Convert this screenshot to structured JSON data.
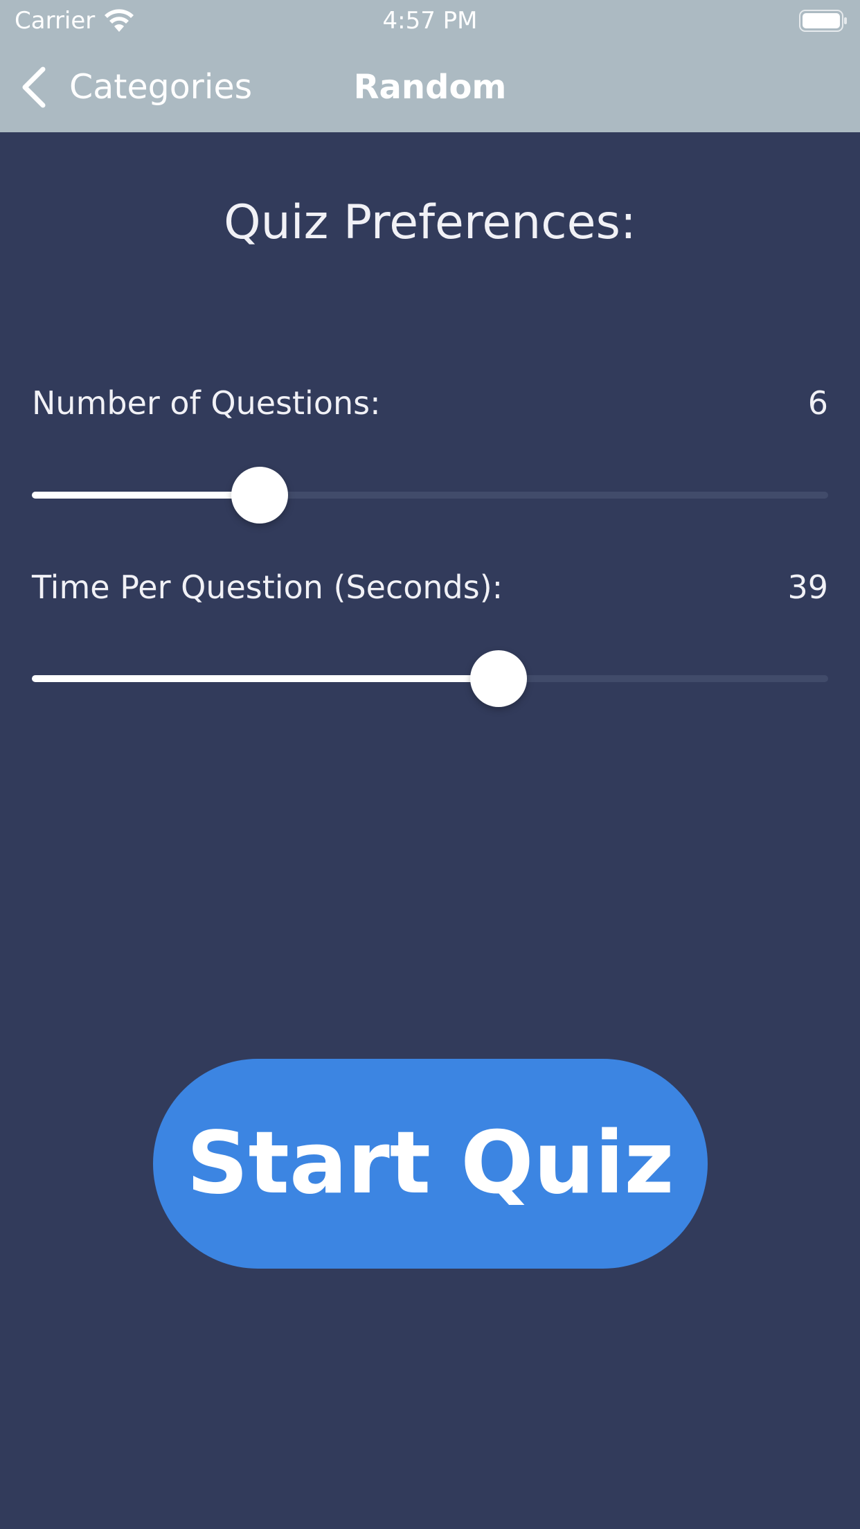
{
  "status_bar": {
    "carrier": "Carrier",
    "time": "4:57 PM",
    "wifi_icon": "wifi-icon",
    "battery_icon": "battery-icon"
  },
  "nav": {
    "back_label": "Categories",
    "back_icon": "chevron-left-icon",
    "title": "Random"
  },
  "preferences": {
    "title": "Quiz Preferences:",
    "questions": {
      "label": "Number of Questions:",
      "value": "6",
      "slider_fraction": 0.286
    },
    "time": {
      "label": "Time Per Question (Seconds):",
      "value": "39",
      "slider_fraction": 0.586
    }
  },
  "start_button": {
    "label": "Start Quiz"
  },
  "colors": {
    "background": "#323b5b",
    "topbar": "#acbac2",
    "accent_button": "#3c85e2",
    "slider_track": "#414b6a",
    "slider_fill": "#ffffff"
  }
}
